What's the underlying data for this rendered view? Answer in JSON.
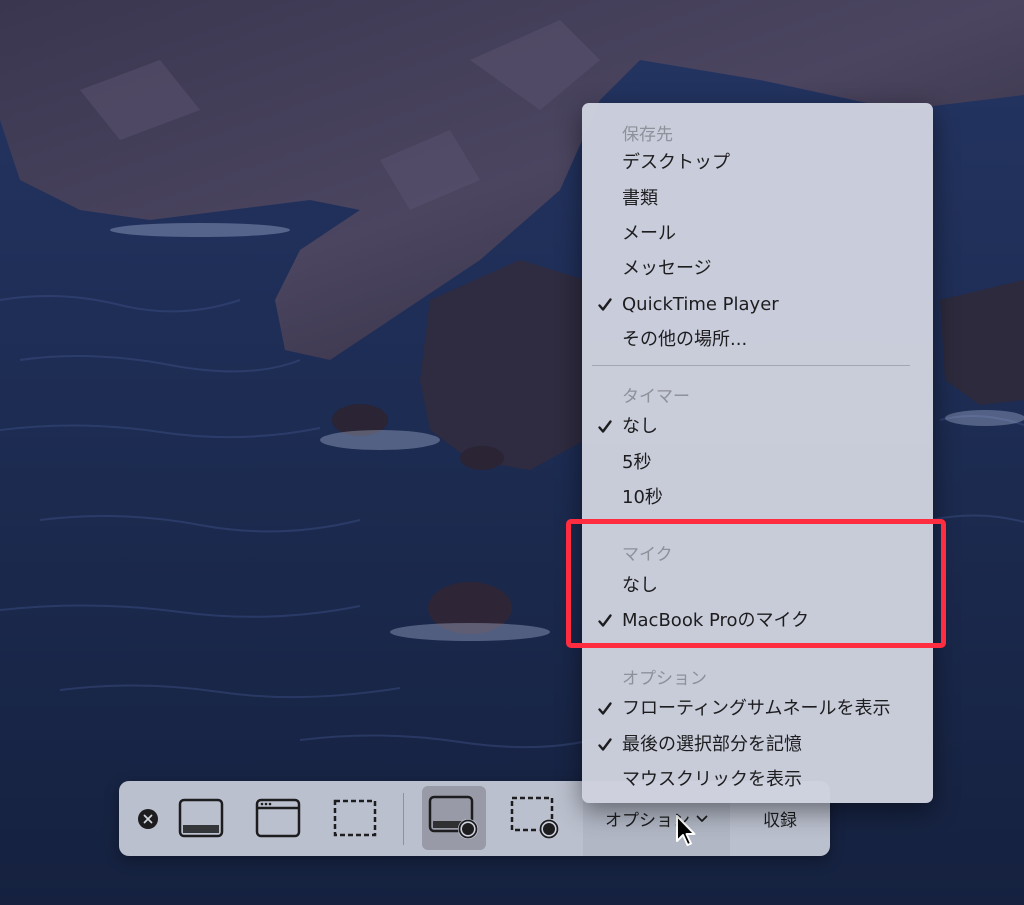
{
  "menu": {
    "sections": [
      {
        "header": "保存先",
        "items": [
          {
            "label": "デスクトップ",
            "checked": false
          },
          {
            "label": "書類",
            "checked": false
          },
          {
            "label": "メール",
            "checked": false
          },
          {
            "label": "メッセージ",
            "checked": false
          },
          {
            "label": "QuickTime Player",
            "checked": true
          },
          {
            "label": "その他の場所...",
            "checked": false
          }
        ]
      },
      {
        "header": "タイマー",
        "items": [
          {
            "label": "なし",
            "checked": true
          },
          {
            "label": "5秒",
            "checked": false
          },
          {
            "label": "10秒",
            "checked": false
          }
        ]
      },
      {
        "header": "マイク",
        "items": [
          {
            "label": "なし",
            "checked": false
          },
          {
            "label": "MacBook Proのマイク",
            "checked": true
          }
        ]
      },
      {
        "header": "オプション",
        "items": [
          {
            "label": "フローティングサムネールを表示",
            "checked": true
          },
          {
            "label": "最後の選択部分を記憶",
            "checked": true
          },
          {
            "label": "マウスクリックを表示",
            "checked": false
          }
        ]
      }
    ]
  },
  "toolbar": {
    "tools": [
      {
        "icon": "capture-entire-screen-icon"
      },
      {
        "icon": "capture-selected-window-icon"
      },
      {
        "icon": "capture-selected-portion-icon"
      },
      {
        "icon": "record-entire-screen-icon",
        "active": true
      },
      {
        "icon": "record-selected-portion-icon"
      }
    ],
    "options_label": "オプション",
    "record_label": "収録"
  },
  "colors": {
    "highlight": "#ff2d3f",
    "menu_bg": "#ced2de",
    "header_text": "#8e909a"
  }
}
